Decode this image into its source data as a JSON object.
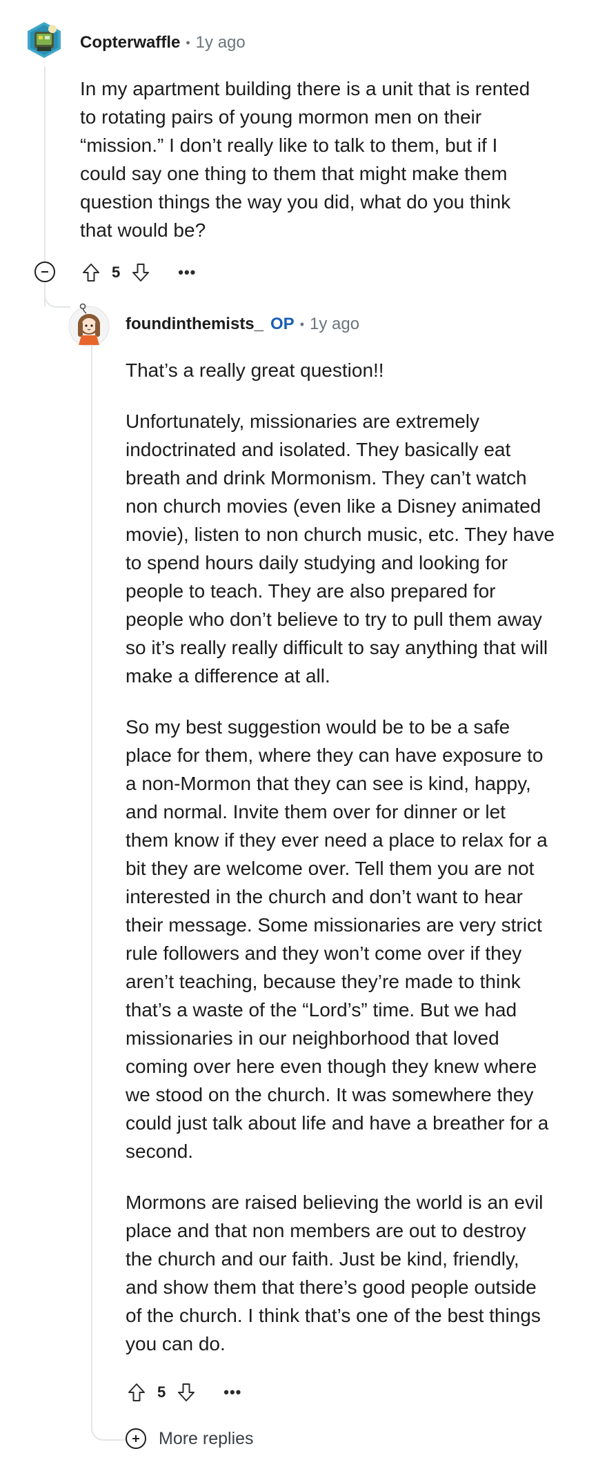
{
  "comment": {
    "author": "Copterwaffle",
    "separator": "•",
    "time": "1y ago",
    "body": [
      "In my apartment building there is a unit that is rented",
      "to rotating pairs of young mormon men on their",
      "“mission.” I don’t really like to talk to them, but if I",
      "could say one thing to them that might make them",
      "question things the way you did, what do you think",
      "that would be?"
    ],
    "score": "5",
    "more": "•••"
  },
  "reply": {
    "author": "foundinthemists_",
    "op_badge": "OP",
    "separator": "•",
    "time": "1y ago",
    "paragraphs": [
      [
        "That’s a really great question!!"
      ],
      [
        "Unfortunately, missionaries are extremely",
        "indoctrinated and isolated. They basically eat",
        "breath and drink Mormonism. They can’t watch",
        "non church movies (even like a Disney animated",
        "movie), listen to non church music, etc. They have",
        "to spend hours daily studying and looking for",
        "people to teach. They are also prepared for",
        "people who don’t believe to try to pull them away",
        "so it’s really really difficult to say anything that will",
        "make a difference at all."
      ],
      [
        "So my best suggestion would be to be a safe",
        "place for them, where they can have exposure to",
        "a non-Mormon that they can see is kind, happy,",
        "and normal. Invite them over for dinner or let",
        "them know if they ever need a place to relax for a",
        "bit they are welcome over. Tell them you are not",
        "interested in the church and don’t want to hear",
        "their message. Some missionaries are very strict",
        "rule followers and they won’t come over if they",
        "aren’t teaching, because they’re made to think",
        "that’s a waste of the “Lord’s” time. But we had",
        "missionaries in our neighborhood that loved",
        "coming over here even though they knew where",
        "we stood on the church. It was somewhere they",
        "could just talk about life and have a breather for a",
        "second."
      ],
      [
        "Mormons are raised believing the world is an evil",
        "place and that non members are out to destroy",
        "the church and our faith. Just be kind, friendly,",
        "and show them that there’s good people outside",
        "of the church. I think that’s one of the best things",
        "you can do."
      ]
    ],
    "score": "5",
    "more": "•••"
  },
  "more_replies_label": "More replies",
  "icons": {
    "upvote": "arrow-up-outline-icon",
    "downvote": "arrow-down-outline-icon",
    "collapse": "minus-circle-icon",
    "expand": "plus-circle-icon"
  },
  "colors": {
    "op_badge": "#1a5fb4",
    "meta_gray": "#6b747a",
    "thread_line": "#e3e6e8"
  }
}
